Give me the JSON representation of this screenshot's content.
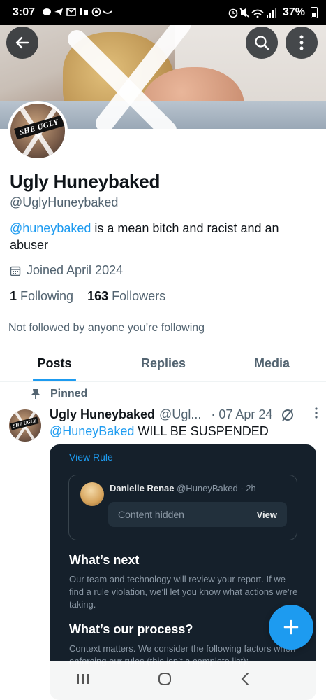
{
  "status_bar": {
    "time": "3:07",
    "battery": "37%",
    "notification_icons": [
      "message-icon",
      "telegram-icon",
      "gmail-icon",
      "teams-icon",
      "at-icon",
      "amazon-icon"
    ],
    "system_icons": [
      "alarm-icon",
      "mute-icon",
      "wifi-icon",
      "signal-icon",
      "battery-icon"
    ]
  },
  "profile": {
    "display_name": "Ugly Huneybaked",
    "handle": "@UglyHuneybaked",
    "avatar_text": "SHE UGLY",
    "bio_mention": "@huneybaked",
    "bio_text": " is a mean bitch and racist and an abuser",
    "joined": "Joined April 2024",
    "following_count": "1",
    "following_label": "Following",
    "followers_count": "163",
    "followers_label": "Followers",
    "not_followed": "Not followed by anyone you’re following"
  },
  "tabs": [
    {
      "label": "Posts",
      "active": true
    },
    {
      "label": "Replies",
      "active": false
    },
    {
      "label": "Media",
      "active": false
    }
  ],
  "post": {
    "pinned_label": "Pinned",
    "author_name": "Ugly Huneybaked",
    "author_handle": "@Ugl...",
    "date": "· 07 Apr 24",
    "text_mention": "@HuneyBaked",
    "text": " WILL BE SUSPENDED",
    "avatar_text": "SHE UGLY",
    "card": {
      "view_rule": "View Rule",
      "quote_name": "Danielle Renae",
      "quote_handle": " @HuneyBaked · 2h",
      "content_hidden": "Content hidden",
      "view_label": "View",
      "whats_next_title": "What’s next",
      "whats_next_body": "Our team and technology will review your report. If we find a rule violation, we’ll let you know what actions we’re taking.",
      "process_title": "What’s our process?",
      "process_body": "Context matters. We consider the following factors when enforcing our rules (this isn’t a complete list):"
    }
  },
  "colors": {
    "accent": "#1d9bf0",
    "text_primary": "#0f1419",
    "text_secondary": "#536471",
    "card_bg": "#15202b"
  }
}
